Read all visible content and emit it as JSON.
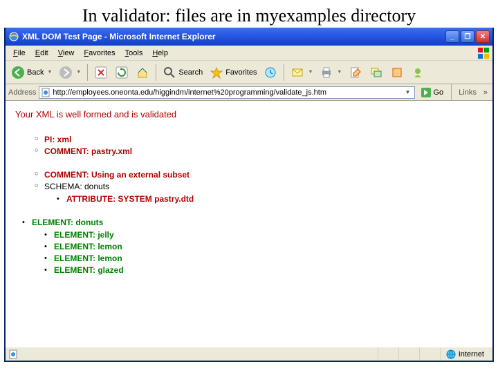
{
  "slide": {
    "title": "In validator: files are in myexamples directory"
  },
  "window": {
    "title": "XML DOM Test Page - Microsoft Internet Explorer",
    "min": "_",
    "max": "❐",
    "close": "✕"
  },
  "menu": {
    "file": "ile",
    "edit": "dit",
    "view": "iew",
    "fav": "avorites",
    "tools": "ools",
    "help": "elp",
    "file_u": "F",
    "edit_u": "E",
    "view_u": "V",
    "fav_u": "F",
    "tools_u": "T",
    "help_u": "H"
  },
  "toolbar": {
    "back": "Back",
    "search": "Search",
    "favorites": "Favorites"
  },
  "address": {
    "label": "Address",
    "url": "http://employees.oneonta.edu/higgindm/internet%20programming/validate_js.htm",
    "go": "Go",
    "links": "Links",
    "chevron": "»"
  },
  "page": {
    "heading": "Your XML is well formed and is validated",
    "items": [
      {
        "style": "circ",
        "color": "red",
        "text": "PI: xml"
      },
      {
        "style": "circ",
        "color": "red",
        "text": "COMMENT: pastry.xml"
      },
      {
        "style": "circ",
        "color": "red",
        "text": "COMMENT: Using an external subset"
      },
      {
        "style": "circ",
        "color": "plain",
        "text": "SCHEMA: donuts"
      }
    ],
    "attr": {
      "style": "disc",
      "color": "red",
      "text": "ATTRIBUTE: SYSTEM pastry.dtd"
    },
    "root": {
      "style": "disc",
      "color": "grn",
      "text": "ELEMENT: donuts"
    },
    "children": [
      {
        "text": "ELEMENT: jelly"
      },
      {
        "text": "ELEMENT: lemon"
      },
      {
        "text": "ELEMENT: lemon"
      },
      {
        "text": "ELEMENT: glazed"
      }
    ]
  },
  "status": {
    "zone": "Internet"
  }
}
